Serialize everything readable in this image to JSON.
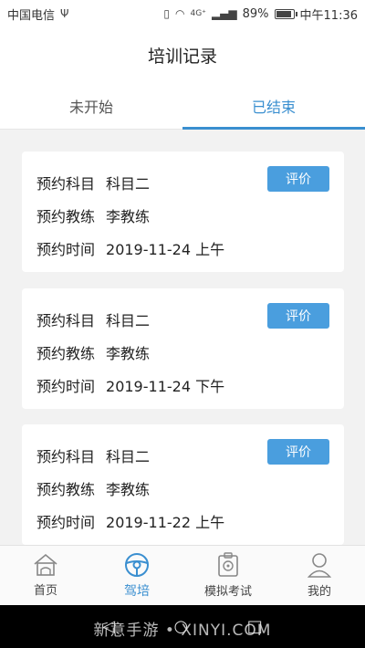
{
  "status_bar": {
    "carrier": "中国电信",
    "usb_icon": "usb-icon",
    "network": "4G⁺",
    "battery": "89%",
    "battery_level": 0.89,
    "time": "中午11:36"
  },
  "header": {
    "title": "培训记录"
  },
  "tabs": [
    {
      "label": "未开始",
      "active": false
    },
    {
      "label": "已结束",
      "active": true
    }
  ],
  "records": [
    {
      "subject_label": "预约科目",
      "subject": "科目二",
      "coach_label": "预约教练",
      "coach": "李教练",
      "time_label": "预约时间",
      "time": "2019-11-24 上午",
      "button": "评价"
    },
    {
      "subject_label": "预约科目",
      "subject": "科目二",
      "coach_label": "预约教练",
      "coach": "李教练",
      "time_label": "预约时间",
      "time": "2019-11-24 下午",
      "button": "评价"
    },
    {
      "subject_label": "预约科目",
      "subject": "科目二",
      "coach_label": "预约教练",
      "coach": "李教练",
      "time_label": "预约时间",
      "time": "2019-11-22 上午",
      "button": "评价"
    }
  ],
  "bottom_nav": [
    {
      "label": "首页",
      "icon": "home-icon"
    },
    {
      "label": "驾培",
      "icon": "steering-wheel-icon",
      "active": true
    },
    {
      "label": "模拟考试",
      "icon": "exam-clipboard-icon"
    },
    {
      "label": "我的",
      "icon": "user-icon"
    }
  ],
  "watermark": "新意手游 • XINYI.COM",
  "colors": {
    "accent": "#3a8fd0",
    "button": "#4a9ede"
  }
}
